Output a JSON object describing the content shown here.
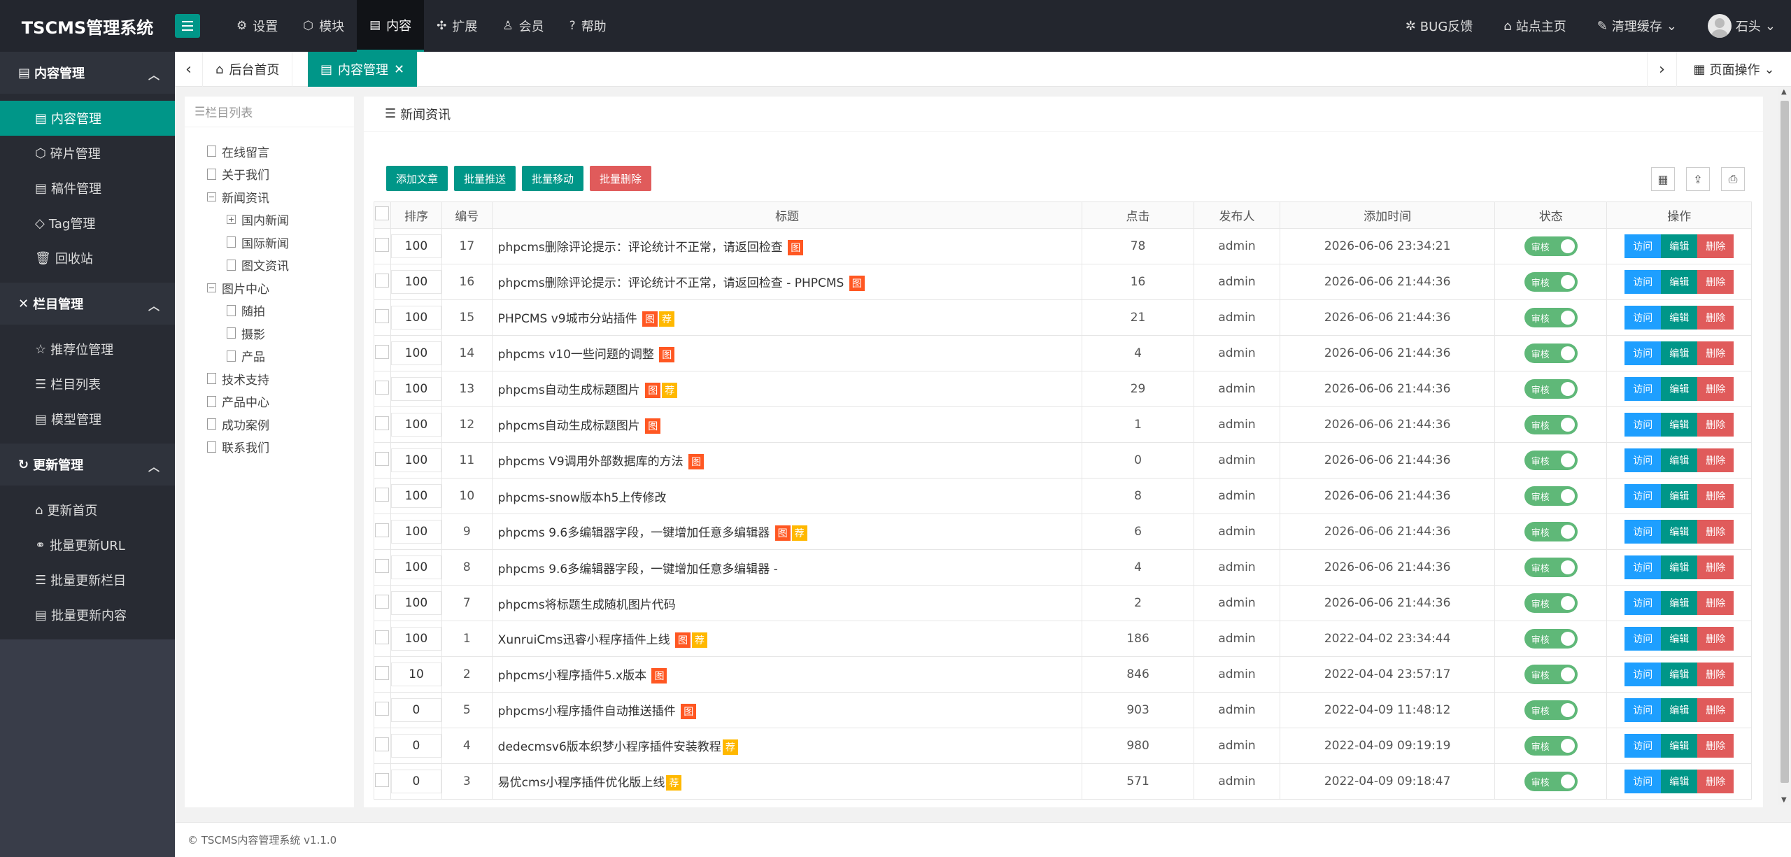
{
  "app": {
    "title": "TSCMS管理系统"
  },
  "topnav": {
    "items": [
      {
        "label": "设置",
        "icon": "gear-icon"
      },
      {
        "label": "模块",
        "icon": "cube-icon"
      },
      {
        "label": "内容",
        "icon": "doc-icon"
      },
      {
        "label": "扩展",
        "icon": "puzzle-icon"
      },
      {
        "label": "会员",
        "icon": "user-icon"
      },
      {
        "label": "帮助",
        "icon": "help-icon"
      }
    ],
    "active": 2
  },
  "topright": {
    "bug": "BUG反馈",
    "site": "站点主页",
    "cache": "清理缓存",
    "user": "石头"
  },
  "sidebar": {
    "groups": [
      {
        "title": "内容管理",
        "items": [
          "内容管理",
          "碎片管理",
          "稿件管理",
          "Tag管理",
          "回收站"
        ]
      },
      {
        "title": "栏目管理",
        "items": [
          "推荐位管理",
          "栏目列表",
          "模型管理"
        ]
      },
      {
        "title": "更新管理",
        "items": [
          "更新首页",
          "批量更新URL",
          "批量更新栏目",
          "批量更新内容"
        ]
      }
    ]
  },
  "tabs": {
    "home": "后台首页",
    "current": "内容管理",
    "page_ops": "页面操作"
  },
  "tree": {
    "title": "栏目列表",
    "nodes": [
      "在线留言",
      "关于我们",
      "新闻资讯",
      "国内新闻",
      "国际新闻",
      "图文资讯",
      "图片中心",
      "随拍",
      "摄影",
      "产品",
      "技术支持",
      "产品中心",
      "成功案例",
      "联系我们"
    ]
  },
  "main": {
    "heading": "新闻资讯",
    "buttons": {
      "add": "添加文章",
      "push": "批量推送",
      "move": "批量移动",
      "delete": "批量删除"
    },
    "columns": {
      "sort": "排序",
      "id": "编号",
      "title": "标题",
      "hits": "点击",
      "author": "发布人",
      "time": "添加时间",
      "status": "状态",
      "ops": "操作"
    },
    "status_label": "审核",
    "op_labels": {
      "visit": "访问",
      "edit": "编辑",
      "del": "删除"
    },
    "tag_labels": {
      "img": "图",
      "rec": "荐"
    },
    "rows": [
      {
        "sort": "100",
        "id": "17",
        "title": "phpcms删除评论提示：评论统计不正常，请返回检查",
        "img": true,
        "rec": false,
        "hits": "78",
        "author": "admin",
        "time": "2026-06-06 23:34:21"
      },
      {
        "sort": "100",
        "id": "16",
        "title": "phpcms删除评论提示：评论统计不正常，请返回检查 - PHPCMS",
        "img": true,
        "rec": false,
        "hits": "16",
        "author": "admin",
        "time": "2026-06-06 21:44:36"
      },
      {
        "sort": "100",
        "id": "15",
        "title": "PHPCMS v9城市分站插件",
        "img": true,
        "rec": true,
        "hits": "21",
        "author": "admin",
        "time": "2026-06-06 21:44:36"
      },
      {
        "sort": "100",
        "id": "14",
        "title": "phpcms v10一些问题的调整",
        "img": true,
        "rec": false,
        "hits": "4",
        "author": "admin",
        "time": "2026-06-06 21:44:36"
      },
      {
        "sort": "100",
        "id": "13",
        "title": "phpcms自动生成标题图片",
        "img": true,
        "rec": true,
        "hits": "29",
        "author": "admin",
        "time": "2026-06-06 21:44:36"
      },
      {
        "sort": "100",
        "id": "12",
        "title": "phpcms自动生成标题图片",
        "img": true,
        "rec": false,
        "hits": "1",
        "author": "admin",
        "time": "2026-06-06 21:44:36"
      },
      {
        "sort": "100",
        "id": "11",
        "title": "phpcms V9调用外部数据库的方法",
        "img": true,
        "rec": false,
        "hits": "0",
        "author": "admin",
        "time": "2026-06-06 21:44:36"
      },
      {
        "sort": "100",
        "id": "10",
        "title": "phpcms-snow版本h5上传修改",
        "img": false,
        "rec": false,
        "hits": "8",
        "author": "admin",
        "time": "2026-06-06 21:44:36"
      },
      {
        "sort": "100",
        "id": "9",
        "title": "phpcms 9.6多编辑器字段，一键增加任意多编辑器",
        "img": true,
        "rec": true,
        "hits": "6",
        "author": "admin",
        "time": "2026-06-06 21:44:36"
      },
      {
        "sort": "100",
        "id": "8",
        "title": "phpcms 9.6多编辑器字段，一键增加任意多编辑器 -",
        "img": false,
        "rec": false,
        "hits": "4",
        "author": "admin",
        "time": "2026-06-06 21:44:36"
      },
      {
        "sort": "100",
        "id": "7",
        "title": "phpcms将标题生成随机图片代码",
        "img": false,
        "rec": false,
        "hits": "2",
        "author": "admin",
        "time": "2026-06-06 21:44:36"
      },
      {
        "sort": "100",
        "id": "1",
        "title": "XunruiCms迅睿小程序插件上线",
        "img": true,
        "rec": true,
        "hits": "186",
        "author": "admin",
        "time": "2022-04-02 23:34:44"
      },
      {
        "sort": "10",
        "id": "2",
        "title": "phpcms小程序插件5.x版本",
        "img": true,
        "rec": false,
        "hits": "846",
        "author": "admin",
        "time": "2022-04-04 23:57:17"
      },
      {
        "sort": "0",
        "id": "5",
        "title": "phpcms小程序插件自动推送插件",
        "img": true,
        "rec": false,
        "hits": "903",
        "author": "admin",
        "time": "2022-04-09 11:48:12"
      },
      {
        "sort": "0",
        "id": "4",
        "title": "dedecmsv6版本织梦小程序插件安装教程",
        "img": false,
        "rec": true,
        "hits": "980",
        "author": "admin",
        "time": "2022-04-09 09:19:19"
      },
      {
        "sort": "0",
        "id": "3",
        "title": "易优cms小程序插件优化版上线",
        "img": false,
        "rec": true,
        "hits": "571",
        "author": "admin",
        "time": "2022-04-09 09:18:47"
      }
    ]
  },
  "footer": {
    "text": "© TSCMS内容管理系统 v1.1.0"
  },
  "colors": {
    "accent": "#009688",
    "header_bg": "#23262e",
    "sidebar_bg": "#393d49",
    "danger": "#e05b5b",
    "info": "#1e9fff",
    "tag_img": "#ff5722",
    "tag_rec": "#ffb800",
    "switch_on": "#5fb878"
  }
}
